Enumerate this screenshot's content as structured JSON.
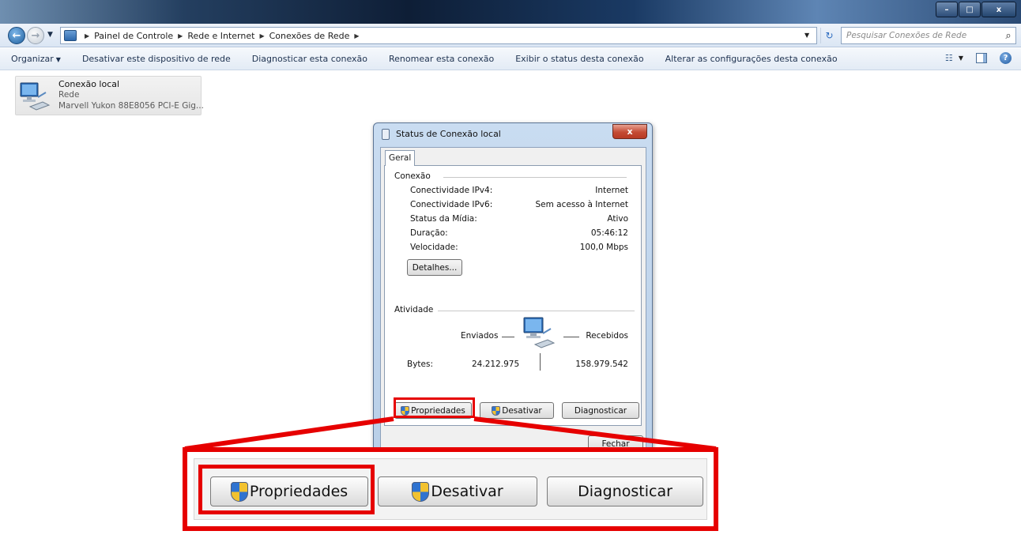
{
  "window": {
    "minimize_glyph": "–",
    "maximize_glyph": "□",
    "close_glyph": "x"
  },
  "address": {
    "crumbs": [
      "Painel de Controle",
      "Rede e Internet",
      "Conexões de Rede"
    ],
    "search_placeholder": "Pesquisar Conexões de Rede"
  },
  "toolbar": {
    "organize": "Organizar",
    "disable_device": "Desativar este dispositivo de rede",
    "diagnose": "Diagnosticar esta conexão",
    "rename": "Renomear esta conexão",
    "view_status": "Exibir o status desta conexão",
    "change_settings": "Alterar as configurações desta conexão"
  },
  "connection": {
    "name": "Conexão local",
    "type": "Rede",
    "device": "Marvell Yukon 88E8056 PCI-E Gig..."
  },
  "dialog": {
    "title": "Status de Conexão local",
    "close_glyph": "x",
    "tab": "Geral",
    "connection_group": "Conexão",
    "rows": [
      {
        "label": "Conectividade IPv4:",
        "value": "Internet"
      },
      {
        "label": "Conectividade IPv6:",
        "value": "Sem acesso à Internet"
      },
      {
        "label": "Status da Mídia:",
        "value": "Ativo"
      },
      {
        "label": "Duração:",
        "value": "05:46:12"
      },
      {
        "label": "Velocidade:",
        "value": "100,0 Mbps"
      }
    ],
    "details_button": "Detalhes...",
    "activity_group": "Atividade",
    "sent_label": "Enviados",
    "received_label": "Recebidos",
    "bytes_label": "Bytes:",
    "bytes_sent": "24.212.975",
    "bytes_received": "158.979.542",
    "properties_button": "Propriedades",
    "disable_button": "Desativar",
    "diagnose_button": "Diagnosticar",
    "close_button": "Fechar"
  },
  "callout": {
    "properties": "Propriedades",
    "disable": "Desativar",
    "diagnose": "Diagnosticar"
  },
  "colors": {
    "highlight": "#e60000",
    "dialog_frame": "#b9cfe8",
    "close_button": "#c44a33"
  }
}
